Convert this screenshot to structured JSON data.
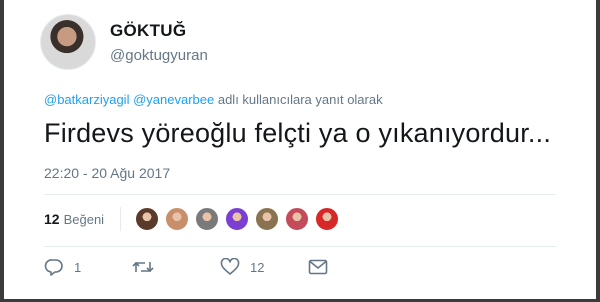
{
  "user": {
    "display_name": "GÖKTUĞ",
    "handle": "@goktugyuran",
    "avatar_icon": "user-avatar"
  },
  "reply": {
    "mention_1": "@batkarziyagil",
    "mention_2": "@yanevarbee",
    "suffix": "adlı kullanıcılara yanıt olarak"
  },
  "tweet": {
    "text": "Firdevs yöreoğlu felçti ya o yıkanıyordur...",
    "timestamp": "22:20 - 20 Ağu 2017"
  },
  "likes": {
    "count": "12",
    "label": "Beğeni",
    "liker_colors": [
      "#5a3b2b",
      "#c98e6a",
      "#7a7a7a",
      "#7b3fd1",
      "#8a7350",
      "#c44b5a",
      "#d62828"
    ]
  },
  "actions": {
    "reply_count": "1",
    "retweet_count": "",
    "like_count": "12",
    "reply_icon": "reply-icon",
    "retweet_icon": "retweet-icon",
    "like_icon": "heart-icon",
    "dm_icon": "message-icon"
  },
  "colors": {
    "link": "#1da1f2",
    "secondary_text": "#657786",
    "primary_text": "#14171a"
  }
}
